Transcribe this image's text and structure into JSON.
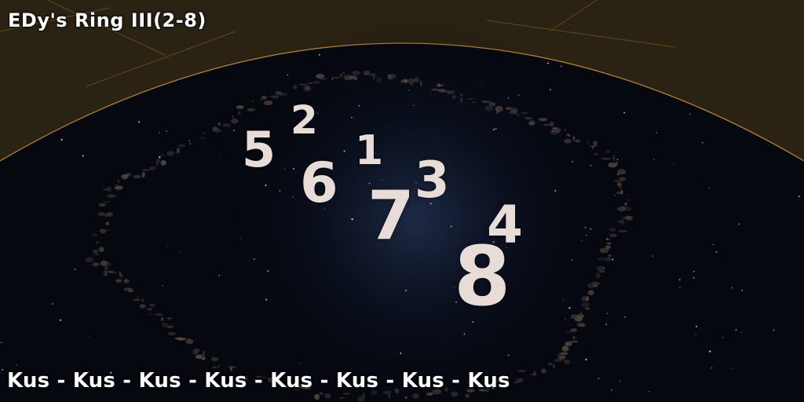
{
  "title": "EDy's Ring III(2-8)",
  "footer": "Kus - Kus - Kus - Kus - Kus - Kus - Kus - Kus",
  "markers": [
    {
      "label": "5"
    },
    {
      "label": "2"
    },
    {
      "label": "6"
    },
    {
      "label": "1"
    },
    {
      "label": "3"
    },
    {
      "label": "7"
    },
    {
      "label": "4"
    },
    {
      "label": "8"
    }
  ],
  "colors": {
    "sky": "#2a2212",
    "horizon_line": "#c08a22",
    "planet": "#05080f",
    "marker_text": "#e7dcd6",
    "asteroids": "#5a4b42"
  }
}
